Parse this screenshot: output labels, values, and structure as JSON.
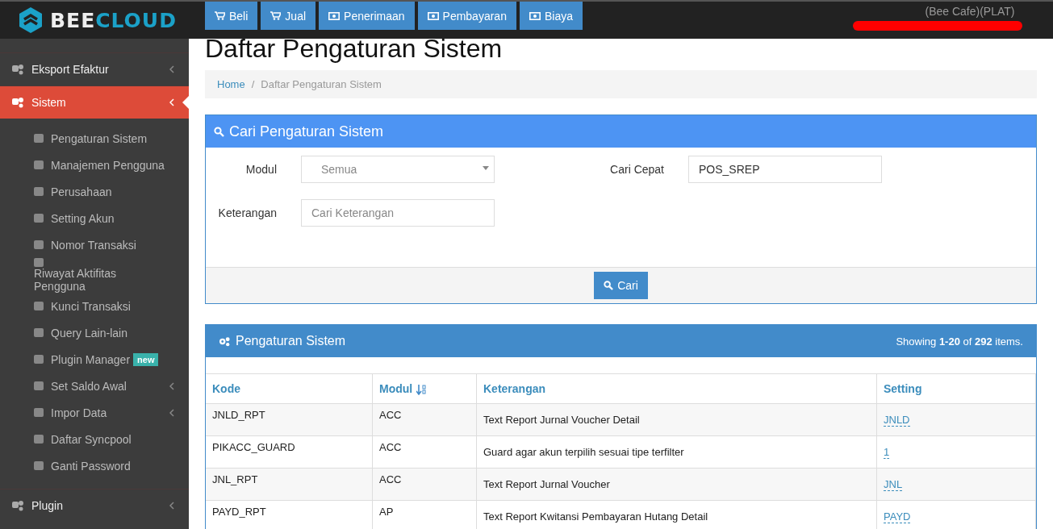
{
  "brand": {
    "part1": "BEE",
    "part2": "CLOUD"
  },
  "top_buttons": [
    {
      "label": "Beli",
      "kind": "cart"
    },
    {
      "label": "Jual",
      "kind": "cart"
    },
    {
      "label": "Penerimaan",
      "kind": "money"
    },
    {
      "label": "Pembayaran",
      "kind": "money"
    },
    {
      "label": "Biaya",
      "kind": "money"
    }
  ],
  "user": {
    "company": "(Bee Cafe)(PLAT)",
    "redacted": true
  },
  "sidebar": {
    "items": [
      {
        "label": "Eksport Efaktur",
        "selected": false,
        "has_submenu": true
      },
      {
        "label": "Sistem",
        "selected": true,
        "expanded": true,
        "has_submenu": true,
        "children": [
          {
            "label": "Pengaturan Sistem",
            "has_submenu": false
          },
          {
            "label": "Manajemen Pengguna",
            "has_submenu": false
          },
          {
            "label": "Perusahaan",
            "has_submenu": false
          },
          {
            "label": "Setting Akun",
            "has_submenu": false
          },
          {
            "label": "Nomor Transaksi",
            "has_submenu": false
          },
          {
            "label": "Riwayat Aktifitas Pengguna",
            "has_submenu": false
          },
          {
            "label": "Kunci Transaksi",
            "has_submenu": false
          },
          {
            "label": "Query Lain-lain",
            "has_submenu": false
          },
          {
            "label": "Plugin Manager",
            "badge": "new",
            "has_submenu": false
          },
          {
            "label": "Set Saldo Awal",
            "has_submenu": true
          },
          {
            "label": "Impor Data",
            "has_submenu": true
          },
          {
            "label": "Daftar Syncpool",
            "has_submenu": false
          },
          {
            "label": "Ganti Password",
            "has_submenu": false
          }
        ]
      },
      {
        "label": "Plugin",
        "selected": false,
        "has_submenu": true
      }
    ]
  },
  "page_title": "Daftar Pengaturan Sistem",
  "breadcrumb": [
    {
      "label": "Home",
      "link": true
    },
    {
      "separator": "/",
      "label": "Daftar Pengaturan Sistem",
      "link": false
    }
  ],
  "search_panel": {
    "title": "Cari Pengaturan Sistem",
    "fields": [
      {
        "label": "Modul",
        "kind": "select",
        "value": "Semua"
      },
      {
        "label": "Cari Cepat",
        "kind": "text",
        "value": "POS_SREP"
      },
      {
        "label": "Keterangan",
        "kind": "text",
        "placeholder": "Cari Keterangan"
      }
    ],
    "button": "Cari"
  },
  "table_panel": {
    "title": "Pengaturan Sistem",
    "summary": "Showing **1-20** of **292** items.",
    "columns": [
      {
        "label": "Kode",
        "sorted": false
      },
      {
        "label": "Modul",
        "sorted": true
      },
      {
        "label": "Keterangan",
        "sorted": false
      },
      {
        "label": "Setting",
        "sorted": false
      }
    ],
    "rows": [
      {
        "kode": "JNLD_RPT",
        "modul": "ACC",
        "keterangan": "Text Report Jurnal Voucher Detail",
        "setting": "JNLD"
      },
      {
        "kode": "PIKACC_GUARD",
        "modul": "ACC",
        "keterangan": "Guard agar akun terpilih sesuai tipe terfilter",
        "setting": "1"
      },
      {
        "kode": "JNL_RPT",
        "modul": "ACC",
        "keterangan": "Text Report Jurnal Voucher",
        "setting": "JNL"
      },
      {
        "kode": "PAYD_RPT",
        "modul": "AP",
        "keterangan": "Text Report Kwitansi Pembayaran Hutang Detail",
        "setting": "PAYD"
      }
    ]
  }
}
